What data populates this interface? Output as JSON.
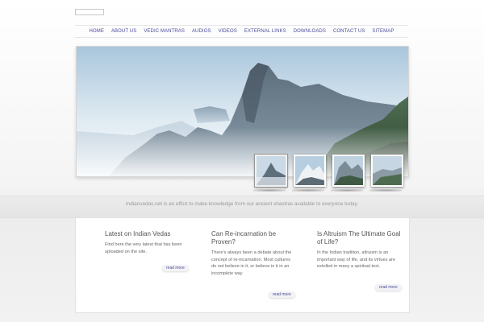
{
  "nav": {
    "items": [
      {
        "label": "HOME"
      },
      {
        "label": "ABOUT US"
      },
      {
        "label": "VEDIC MANTRAS"
      },
      {
        "label": "AUDIOS"
      },
      {
        "label": "VIDEOS"
      },
      {
        "label": "EXTERNAL LINKS"
      },
      {
        "label": "DOWNLOADS"
      },
      {
        "label": "CONTACT US"
      },
      {
        "label": "SITEMAP"
      }
    ]
  },
  "hero": {
    "description": "",
    "thumbnails": [
      {
        "active": true
      },
      {
        "active": false
      },
      {
        "active": false
      },
      {
        "active": false
      }
    ]
  },
  "tagline": "Indianvedas.net is an effort to make knowledge from our ancient shastras available to everyone today.",
  "columns": [
    {
      "title": "Latest on Indian Vedas",
      "text": "Find here the very latest that has been uploaded on the site.",
      "more": "read more"
    },
    {
      "title": "Can Re-incarnation be Proven?",
      "text": "There's always been a debate about the concept of re-incarnation. Most cultures do not believe in it, or believe in it in an incomplete way",
      "more": "read more"
    },
    {
      "title": "Is Altruism The Ultimate Goal of Life?",
      "text": "In the Indian tradition, altruism is an important way of life, and its virtues are extolled in many a spiritual text.",
      "more": "read more"
    }
  ],
  "colors": {
    "nav_link": "#4b4b9b",
    "text_gray": "#666666",
    "heading": "#555555"
  }
}
